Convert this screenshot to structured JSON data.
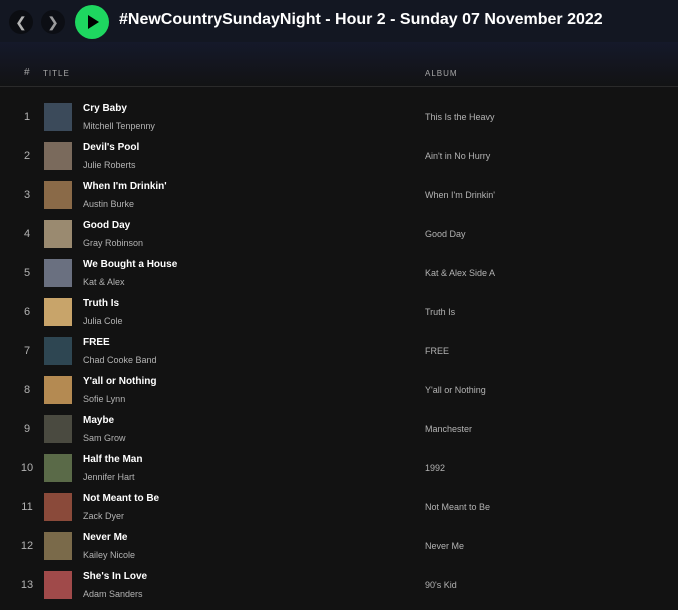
{
  "header": {
    "back_icon": "chevron-left-icon",
    "forward_icon": "chevron-right-icon",
    "play_icon": "play-icon",
    "title": "#NewCountrySundayNight - Hour 2 - Sunday 07 November 2022"
  },
  "columns": {
    "number": "#",
    "title": "TITLE",
    "album": "ALBUM"
  },
  "colors": {
    "accent": "#1ed760",
    "background": "#121212",
    "topbar": "#131722"
  },
  "tracks": [
    {
      "num": "1",
      "title": "Cry Baby",
      "artist": "Mitchell Tenpenny",
      "album": "This Is the Heavy",
      "art": "#3b4a5a"
    },
    {
      "num": "2",
      "title": "Devil's Pool",
      "artist": "Julie Roberts",
      "album": "Ain't in No Hurry",
      "art": "#7a6a5c"
    },
    {
      "num": "3",
      "title": "When I'm Drinkin'",
      "artist": "Austin Burke",
      "album": "When I'm Drinkin'",
      "art": "#8a6a48"
    },
    {
      "num": "4",
      "title": "Good Day",
      "artist": "Gray Robinson",
      "album": "Good Day",
      "art": "#9a8a70"
    },
    {
      "num": "5",
      "title": "We Bought a House",
      "artist": "Kat & Alex",
      "album": "Kat & Alex Side A",
      "art": "#6a7080"
    },
    {
      "num": "6",
      "title": "Truth Is",
      "artist": "Julia Cole",
      "album": "Truth Is",
      "art": "#c8a46a"
    },
    {
      "num": "7",
      "title": "FREE",
      "artist": "Chad Cooke Band",
      "album": "FREE",
      "art": "#2e4652"
    },
    {
      "num": "8",
      "title": "Y'all or Nothing",
      "artist": "Sofie Lynn",
      "album": "Y'all or Nothing",
      "art": "#b48a52"
    },
    {
      "num": "9",
      "title": "Maybe",
      "artist": "Sam Grow",
      "album": "Manchester",
      "art": "#4a4a40"
    },
    {
      "num": "10",
      "title": "Half the Man",
      "artist": "Jennifer Hart",
      "album": "1992",
      "art": "#5a6a48"
    },
    {
      "num": "11",
      "title": "Not Meant to Be",
      "artist": "Zack Dyer",
      "album": "Not Meant to Be",
      "art": "#8a4a3a"
    },
    {
      "num": "12",
      "title": "Never Me",
      "artist": "Kailey Nicole",
      "album": "Never Me",
      "art": "#7a6a4a"
    },
    {
      "num": "13",
      "title": "She's In Love",
      "artist": "Adam Sanders",
      "album": "90's Kid",
      "art": "#a04a4a"
    }
  ]
}
